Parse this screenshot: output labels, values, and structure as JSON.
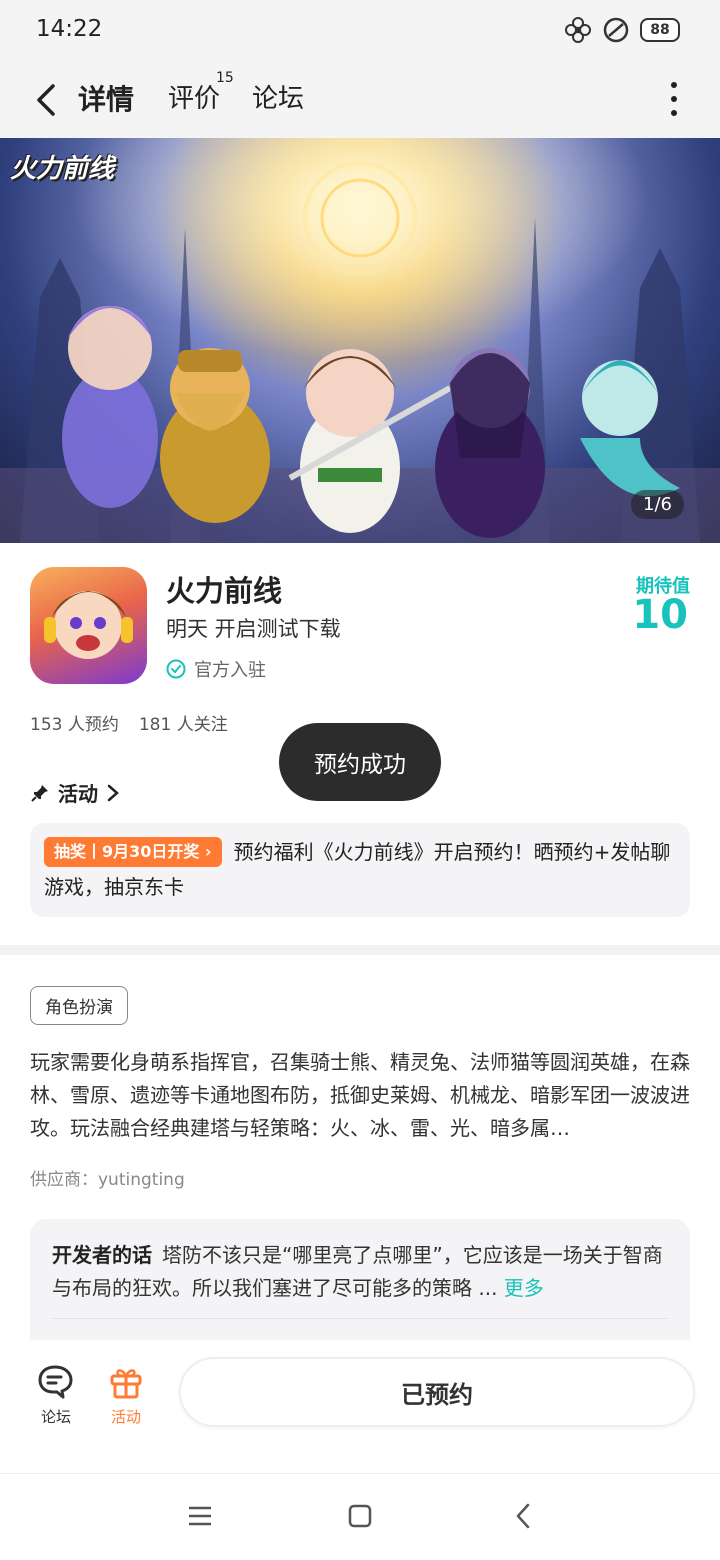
{
  "status_bar": {
    "time": "14:22",
    "battery": "88",
    "icons": [
      "flower-notification-icon",
      "no-disturb-icon",
      "battery-icon"
    ]
  },
  "nav": {
    "tabs": [
      {
        "label": "详情",
        "active": true
      },
      {
        "label": "评价",
        "badge": "15"
      },
      {
        "label": "论坛"
      }
    ],
    "accent_color": "#2dd3c8"
  },
  "banner": {
    "logo_text": "火力前线",
    "counter": "1/6"
  },
  "app": {
    "name": "火力前线",
    "subtitle": "明天 开启测试下载",
    "official_label": "官方入驻",
    "expect_label": "期待值",
    "expect_value": "10",
    "expect_color": "#18c3bb"
  },
  "stats": {
    "reservations": "153 人预约",
    "followers": "181 人关注"
  },
  "toast": "预约成功",
  "activity": {
    "heading": "活动",
    "tag": "抽奖丨9月30日开奖",
    "text": "预约福利《火力前线》开启预约！晒预约+发帖聊游戏，抽京东卡",
    "tag_color": "#ff7a33"
  },
  "genre_tag": "角色扮演",
  "description": "玩家需要化身萌系指挥官，召集骑士熊、精灵兔、法师猫等圆润英雄，在森林、雪原、遗迹等卡通地图布防，抵御史莱姆、机械龙、暗影军团一波波进攻。玩法融合经典建塔与轻策略：火、冰、雷、光、暗多属…",
  "supplier": "供应商：yutingting",
  "developer": {
    "title": "开发者的话",
    "text": "塔防不该只是“哪里亮了点哪里”，它应该是一场关于智商与布局的狂欢。所以我们塞进了尽可能多的策略 ...",
    "more": "更多"
  },
  "bottom_bar": {
    "forum_label": "论坛",
    "activity_label": "活动",
    "reserved_label": "已预约"
  }
}
